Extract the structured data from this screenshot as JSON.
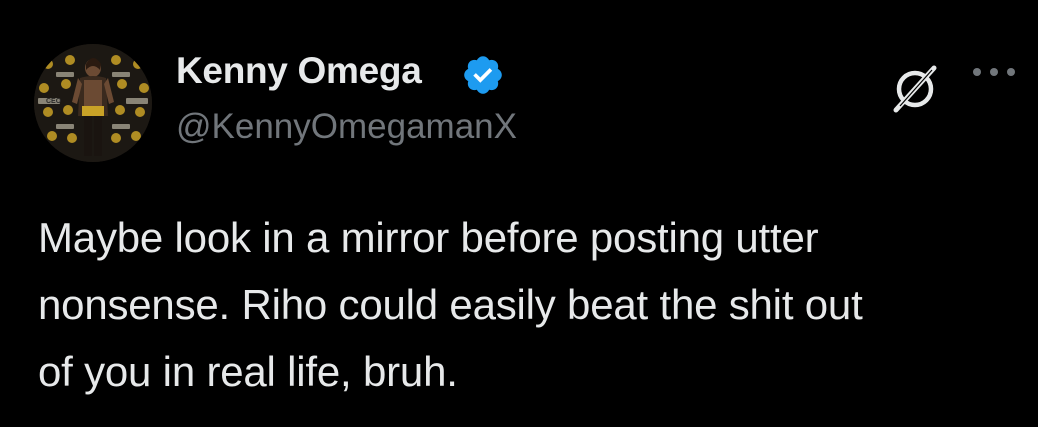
{
  "tweet": {
    "author": {
      "display_name": "Kenny Omega",
      "handle": "@KennyOmegamanX",
      "verified": true,
      "avatar_icon": "profile-photo",
      "avatar_banner_text": "CEO"
    },
    "text": "Maybe look in a mirror before posting utter\nnonsense. Riho could easily beat the shit out\nof you in real life, bruh.",
    "actions": {
      "grok_icon": "grok-icon",
      "more_icon": "more-horizontal-icon"
    }
  },
  "colors": {
    "background": "#000000",
    "primary_text": "#e7e9ea",
    "secondary_text": "#71767b",
    "verified_blue": "#1d9bf0",
    "avatar_gold": "#c9a227"
  }
}
